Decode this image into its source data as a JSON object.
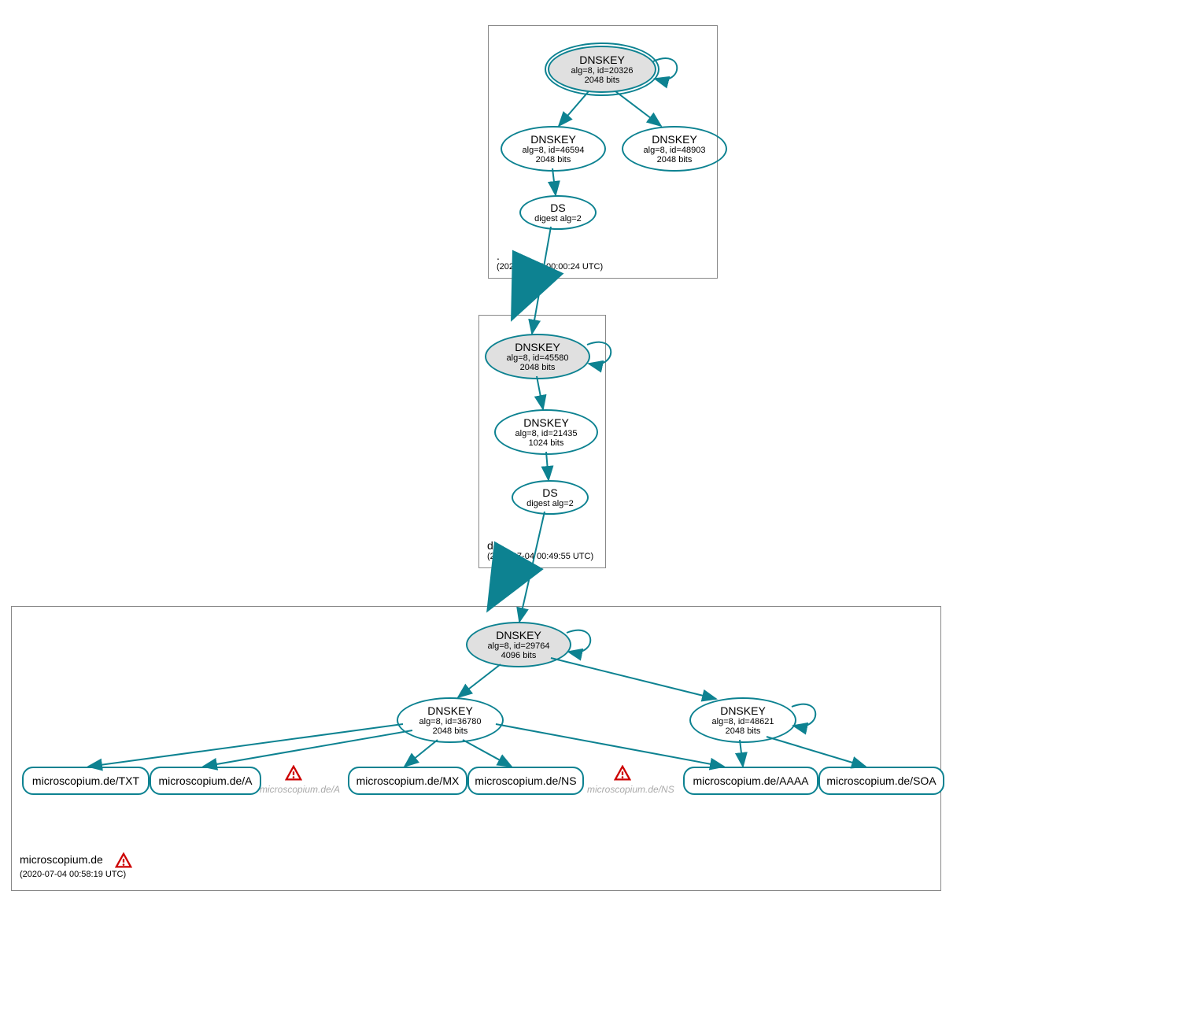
{
  "zones": {
    "root": {
      "name": ".",
      "timestamp": "(2020-07-04 00:00:24 UTC)"
    },
    "de": {
      "name": "de",
      "timestamp": "(2020-07-04 00:49:55 UTC)"
    },
    "domain": {
      "name": "microscopium.de",
      "timestamp": "(2020-07-04 00:58:19 UTC)"
    }
  },
  "nodes": {
    "root_ksk": {
      "title": "DNSKEY",
      "line2": "alg=8, id=20326",
      "line3": "2048 bits"
    },
    "root_zsk1": {
      "title": "DNSKEY",
      "line2": "alg=8, id=46594",
      "line3": "2048 bits"
    },
    "root_zsk2": {
      "title": "DNSKEY",
      "line2": "alg=8, id=48903",
      "line3": "2048 bits"
    },
    "root_ds": {
      "title": "DS",
      "line2": "digest alg=2"
    },
    "de_ksk": {
      "title": "DNSKEY",
      "line2": "alg=8, id=45580",
      "line3": "2048 bits"
    },
    "de_zsk": {
      "title": "DNSKEY",
      "line2": "alg=8, id=21435",
      "line3": "1024 bits"
    },
    "de_ds": {
      "title": "DS",
      "line2": "digest alg=2"
    },
    "dom_ksk": {
      "title": "DNSKEY",
      "line2": "alg=8, id=29764",
      "line3": "4096 bits"
    },
    "dom_zsk1": {
      "title": "DNSKEY",
      "line2": "alg=8, id=36780",
      "line3": "2048 bits"
    },
    "dom_zsk2": {
      "title": "DNSKEY",
      "line2": "alg=8, id=48621",
      "line3": "2048 bits"
    }
  },
  "rr": {
    "txt": "microscopium.de/TXT",
    "a": "microscopium.de/A",
    "mx": "microscopium.de/MX",
    "ns": "microscopium.de/NS",
    "aaaa": "microscopium.de/AAAA",
    "soa": "microscopium.de/SOA"
  },
  "faded": {
    "a": "microscopium.de/A",
    "ns": "microscopium.de/NS"
  }
}
